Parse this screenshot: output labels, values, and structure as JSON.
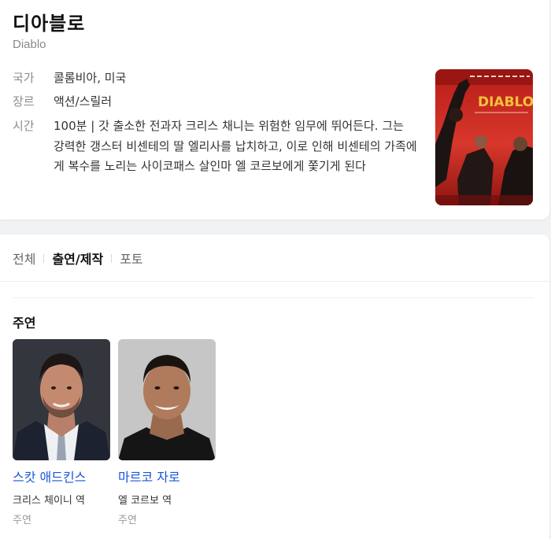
{
  "movie": {
    "title": "디아블로",
    "original_title": "Diablo",
    "info": [
      {
        "label": "국가",
        "value": "콜롬비아, 미국"
      },
      {
        "label": "장르",
        "value": "액션/스릴러"
      },
      {
        "label": "시간",
        "value": "100분 | 갓 출소한 전과자 크리스 채니는 위험한 임무에 뛰어든다. 그는 강력한 갱스터 비센테의 딸 엘리사를 납치하고, 이로 인해 비센테의 가족에게 복수를 노리는 사이코패스 살인마 엘 코르보에게 쫓기게 된다"
      }
    ],
    "poster_text": "DIABLO"
  },
  "tabs": [
    {
      "label": "전체",
      "active": false
    },
    {
      "label": "출연/제작",
      "active": true
    },
    {
      "label": "포토",
      "active": false
    }
  ],
  "cast_section": {
    "title": "주연",
    "people": [
      {
        "name": "스캇 애드킨스",
        "role": "크리스 체이니 역",
        "type": "주연"
      },
      {
        "name": "마르코 자로",
        "role": "엘 코르보 역",
        "type": "주연"
      }
    ]
  },
  "colors": {
    "link": "#1a56db",
    "poster_accent": "#c8231e",
    "poster_title": "#f2c23a"
  }
}
